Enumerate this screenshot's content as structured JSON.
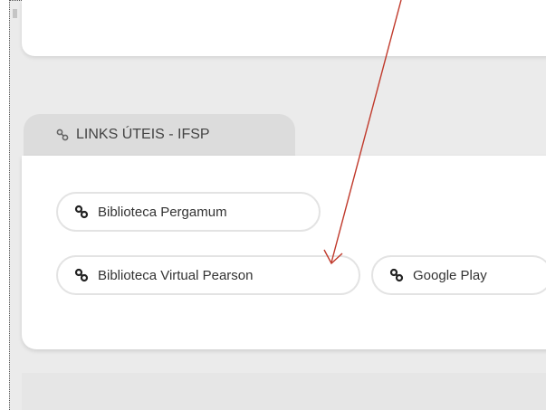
{
  "section": {
    "tab_label": "LINKS ÚTEIS - IFSP",
    "tab_icon": "link-icon"
  },
  "links": [
    {
      "label": "Biblioteca Pergamum",
      "icon": "link-icon"
    },
    {
      "label": "Biblioteca Virtual Pearson",
      "icon": "link-icon"
    },
    {
      "label": "Google Play",
      "icon": "link-icon"
    }
  ],
  "annotation": {
    "type": "arrow",
    "color": "#c0392b",
    "target": "Biblioteca Virtual Pearson"
  }
}
